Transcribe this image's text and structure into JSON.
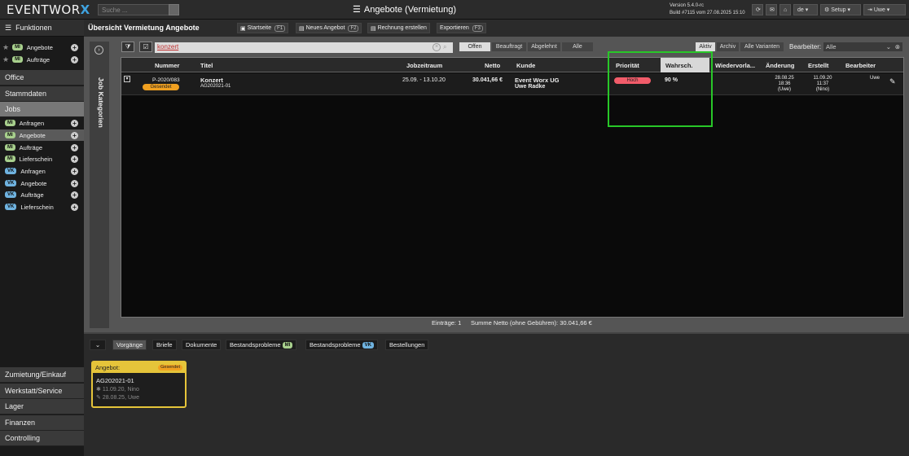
{
  "app": {
    "logo_text": "EVENTWOR",
    "logo_x": "X",
    "search_placeholder": "Suche ...",
    "title": "Angebote (Vermietung)",
    "version_line1": "Version 5.4.0-rc",
    "version_line2": "Build #7115 vom 27.08.2025 15:10",
    "lang": "de",
    "setup_label": "Setup",
    "user_label": "Uwe"
  },
  "sidebar": {
    "header": "Funktionen",
    "favorites": [
      {
        "badge": "MI",
        "label": "Angebote"
      },
      {
        "badge": "MI",
        "label": "Aufträge"
      }
    ],
    "sections_top": [
      "Office",
      "Stammdaten",
      "Jobs"
    ],
    "jobs": [
      {
        "badge": "MI",
        "label": "Anfragen"
      },
      {
        "badge": "MI",
        "label": "Angebote"
      },
      {
        "badge": "MI",
        "label": "Aufträge"
      },
      {
        "badge": "MI",
        "label": "Lieferschein"
      },
      {
        "badge": "VK",
        "label": "Anfragen"
      },
      {
        "badge": "VK",
        "label": "Angebote"
      },
      {
        "badge": "VK",
        "label": "Aufträge"
      },
      {
        "badge": "VK",
        "label": "Lieferschein"
      }
    ],
    "sections_bottom": [
      "Zumietung/Einkauf",
      "Werkstatt/Service",
      "Lager",
      "Finanzen",
      "Controlling"
    ]
  },
  "main": {
    "title": "Übersicht Vermietung Angebote",
    "buttons": [
      {
        "label": "Startseite",
        "key": "F1"
      },
      {
        "label": "Neues Angebot",
        "key": "F2"
      },
      {
        "label": "Rechnung erstellen",
        "key": ""
      },
      {
        "label": "Exportieren",
        "key": "F3"
      }
    ],
    "category_label": "Job Kategorien",
    "search_value": "konzert",
    "status_filters": [
      "Offen",
      "Beauftragt",
      "Abgelehnt",
      "Alle"
    ],
    "scope_filters": [
      "Aktiv",
      "Archiv",
      "Alle Varianten"
    ],
    "bearbeiter_label": "Bearbeiter:",
    "bearbeiter_value": "Alle"
  },
  "table": {
    "columns": [
      "Nummer",
      "Titel",
      "Jobzeitraum",
      "Netto",
      "Kunde",
      "Priorität",
      "Wahrsch.",
      "Wiedervorla...",
      "Änderung",
      "Erstellt",
      "Bearbeiter"
    ],
    "rows": [
      {
        "nummer": "P-2020/083",
        "status": "Gesendet",
        "titel": "Konzert",
        "titel_sub": "AG202021-01",
        "zeitraum": "25.09. - 13.10.20",
        "netto": "30.041,66 €",
        "kunde": "Event Worx UG",
        "kunde_sub": "Uwe Radke",
        "prioritaet": "Hoch",
        "wahrsch": "90 %",
        "aenderung": [
          "28.08.25",
          "18:36",
          "(Uwe)"
        ],
        "erstellt": [
          "11.09.20",
          "11:37",
          "(Nino)"
        ],
        "bearbeiter": "Uwe"
      }
    ],
    "footer_entries": "Einträge: 1",
    "footer_sum": "Summe Netto (ohne Gebühren): 30.041,66 €"
  },
  "bottom": {
    "tabs": [
      {
        "label": "Vorgänge",
        "badge": ""
      },
      {
        "label": "Briefe",
        "badge": ""
      },
      {
        "label": "Dokumente",
        "badge": ""
      },
      {
        "label": "Bestandsprobleme",
        "badge": "MI"
      },
      {
        "label": "Bestandsprobleme",
        "badge": "VK"
      },
      {
        "label": "Bestellungen",
        "badge": ""
      }
    ],
    "card": {
      "head": "Angebot:",
      "badge": "Gesendet",
      "number": "AG202021-01",
      "created": "11.09.20, Nino",
      "edited": "28.08.25, Uwe"
    }
  },
  "colors": {
    "accent_blue": "#3fa3e0",
    "badge_mi": "#a8d08d",
    "badge_vk": "#6fb3e0",
    "status_orange": "#f0a020",
    "priority_red": "#f25c6a",
    "highlight_green": "#28c728",
    "card_yellow": "#e5c43a"
  }
}
